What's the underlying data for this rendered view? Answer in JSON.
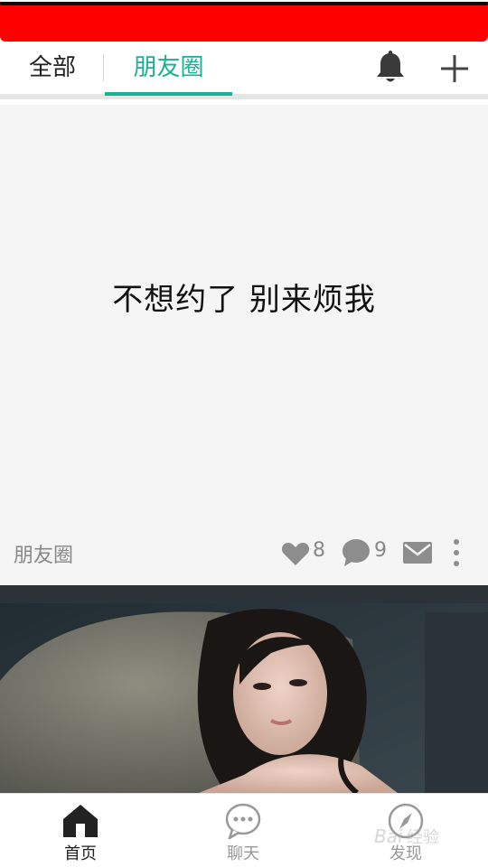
{
  "status_bar": {
    "color": "#ff0000"
  },
  "top_nav": {
    "tabs": [
      {
        "label": "全部",
        "active": false
      },
      {
        "label": "朋友圈",
        "active": true
      }
    ],
    "accent": "#17b193",
    "icons": {
      "notifications": "bell-icon",
      "add": "plus-icon"
    }
  },
  "post": {
    "text": "不想约了 别来烦我",
    "tag": "朋友圈",
    "likes": "8",
    "comments": "9",
    "icons": [
      "heart-icon",
      "comment-icon",
      "mail-icon",
      "more-vertical-icon"
    ]
  },
  "photo_post": {
    "icon": "photo-woman-image"
  },
  "bottom_nav": {
    "items": [
      {
        "label": "首页",
        "icon": "home-icon",
        "active": true
      },
      {
        "label": "聊天",
        "icon": "chat-bubble-icon",
        "active": false
      },
      {
        "label": "发现",
        "icon": "compass-icon",
        "active": false
      }
    ]
  },
  "watermark": {
    "text": "Bai经验"
  }
}
